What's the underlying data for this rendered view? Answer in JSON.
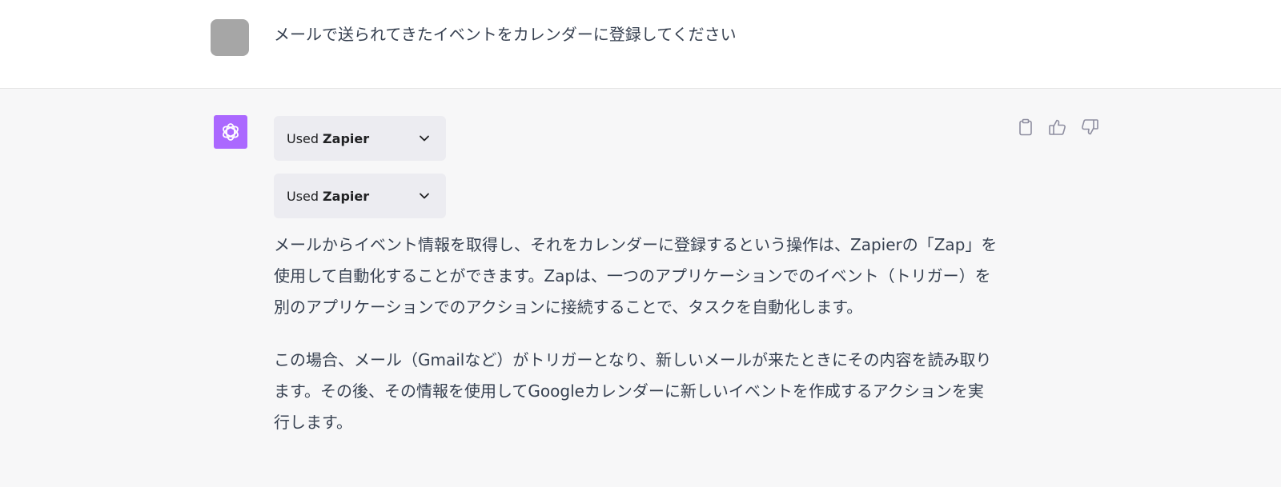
{
  "user_message": {
    "text": "メールで送られてきたイベントをカレンダーに登録してください"
  },
  "assistant": {
    "plugin_calls": [
      {
        "prefix": "Used",
        "name": "Zapier",
        "icon": "chevron-down-icon"
      },
      {
        "prefix": "Used",
        "name": "Zapier",
        "icon": "chevron-down-icon"
      }
    ],
    "paragraphs": [
      "メールからイベント情報を取得し、それをカレンダーに登録するという操作は、Zapierの「Zap」を使用して自動化することができます。Zapは、一つのアプリケーションでのイベント（トリガー）を別のアプリケーションでのアクションに接続することで、タスクを自動化します。",
      "この場合、メール（Gmailなど）がトリガーとなり、新しいメールが来たときにその内容を読み取ります。その後、その情報を使用してGoogleカレンダーに新しいイベントを作成するアクションを実行します。"
    ],
    "actions": [
      "clipboard-icon",
      "thumbs-up-icon",
      "thumbs-down-icon"
    ]
  },
  "colors": {
    "assistant_avatar_bg": "#ab68ff",
    "user_avatar_bg": "#a6a6a6",
    "pill_bg": "#ececf1",
    "assistant_row_bg": "#f7f7f8"
  }
}
